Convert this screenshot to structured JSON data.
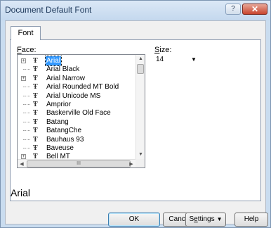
{
  "window": {
    "title": "Document Default Font",
    "help_glyph": "?",
    "close_glyph": "✕"
  },
  "tabs": [
    {
      "label": "Font",
      "active": true
    }
  ],
  "face": {
    "label_prefix": "",
    "label_hotkey": "F",
    "label_rest": "ace:",
    "items": [
      {
        "name": "Arial",
        "expandable": true,
        "selected": true
      },
      {
        "name": "Arial Black",
        "expandable": false,
        "selected": false
      },
      {
        "name": "Arial Narrow",
        "expandable": true,
        "selected": false
      },
      {
        "name": "Arial Rounded MT Bold",
        "expandable": false,
        "selected": false
      },
      {
        "name": "Arial Unicode MS",
        "expandable": false,
        "selected": false
      },
      {
        "name": "Amprior",
        "expandable": false,
        "selected": false
      },
      {
        "name": "Baskerville Old Face",
        "expandable": false,
        "selected": false
      },
      {
        "name": "Batang",
        "expandable": false,
        "selected": false
      },
      {
        "name": "BatangChe",
        "expandable": false,
        "selected": false
      },
      {
        "name": "Bauhaus 93",
        "expandable": false,
        "selected": false
      },
      {
        "name": "Baveuse",
        "expandable": false,
        "selected": false
      },
      {
        "name": "Bell MT",
        "expandable": true,
        "selected": false
      }
    ],
    "tt_glyph": "Ŧ",
    "scroll_up": "▲",
    "scroll_down": "▼",
    "scroll_left": "◀",
    "scroll_right": "▶",
    "hthumb_grip": "III"
  },
  "size": {
    "label_hotkey": "S",
    "label_rest": "ize:",
    "value": "14",
    "arrow": "▼"
  },
  "preview": {
    "text": "Arial"
  },
  "buttons": {
    "ok": "OK",
    "cancel": "Cancel",
    "settings_hotkey": "S",
    "settings_e": "e",
    "settings_rest": "ttings",
    "settings_arrow": "▼",
    "help": "Help"
  }
}
